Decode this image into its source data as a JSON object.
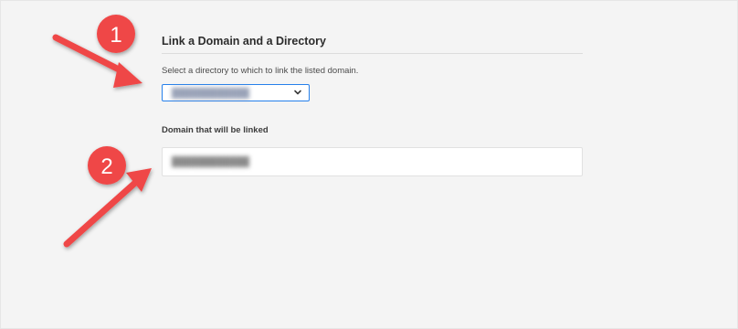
{
  "form": {
    "title": "Link a Domain and a Directory",
    "directory_helper": "Select a directory to which to link the listed domain.",
    "directory_selected": "████████████",
    "domain_label": "Domain that will be linked",
    "domain_value": "████████████"
  },
  "annotations": {
    "step_1": "1",
    "step_2": "2",
    "accent_color": "#ef4747"
  },
  "colors": {
    "background": "#f4f4f4",
    "focus_border": "#2680eb"
  }
}
